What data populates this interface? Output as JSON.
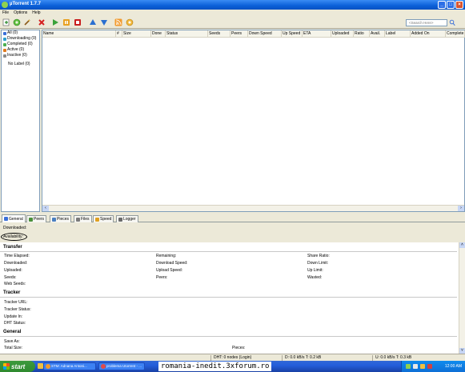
{
  "window": {
    "title": "µTorrent 1.7.7"
  },
  "menu": [
    "File",
    "Options",
    "Help"
  ],
  "toolbar": {
    "buttons": [
      "add-torrent-icon",
      "add-url-icon",
      "create-torrent-icon",
      "remove-icon",
      "start-icon",
      "pause-icon",
      "stop-icon",
      "move-up-icon",
      "move-down-icon",
      "rss-icon",
      "preferences-icon"
    ],
    "search_placeholder": "<Search Here>"
  },
  "sidebar": {
    "items": [
      {
        "label": "All (0)",
        "color": "#3a6fd8"
      },
      {
        "label": "Downloading (0)",
        "color": "#2f9fd0"
      },
      {
        "label": "Completed (0)",
        "color": "#4caf50"
      },
      {
        "label": "Active (0)",
        "color": "#e07a1f"
      },
      {
        "label": "Inactive (0)",
        "color": "#8b8b8b"
      }
    ],
    "no_label": "No Label (0)"
  },
  "columns": [
    "Name",
    "#",
    "Size",
    "Done",
    "Status",
    "Seeds",
    "Peers",
    "Down Speed",
    "Up Speed",
    "ETA",
    "Uploaded",
    "Ratio",
    "Avail.",
    "Label",
    "Added On",
    "Complete"
  ],
  "tabs": [
    {
      "label": "General",
      "color": "#3a6fd8"
    },
    {
      "label": "Peers",
      "color": "#4a8f3a"
    },
    {
      "label": "Pieces",
      "color": "#4a7fc0"
    },
    {
      "label": "Files",
      "color": "#7a7a7a"
    },
    {
      "label": "Speed",
      "color": "#e0a020"
    },
    {
      "label": "Logger",
      "color": "#6a6a6a"
    }
  ],
  "general": {
    "downloaded": "Downloaded:",
    "availability": "Availability:",
    "transfer": {
      "title": "Transfer",
      "col1": [
        "Time Elapsed:",
        "Downloaded:",
        "Uploaded:",
        "Seeds:",
        "Web Seeds:"
      ],
      "col2": [
        "Remaining:",
        "Download Speed:",
        "Upload Speed:",
        "Peers:"
      ],
      "col3": [
        "Share Ratio:",
        "Down Limit:",
        "Up Limit:",
        "Wasted:"
      ]
    },
    "tracker": {
      "title": "Tracker",
      "rows": [
        "Tracker URL:",
        "Tracker Status:",
        "Update In:",
        "DHT Status:"
      ]
    },
    "general_section": {
      "title": "General",
      "save_as": "Save As:",
      "total_size": "Total Size:",
      "pieces": "Pieces:"
    }
  },
  "statusbar": {
    "dht": "DHT: 0 nodes (Login)",
    "down": "D: 0.0 kB/s T: 0.2 kB",
    "up": "U: 0.0 kB/s T: 0.3 kB"
  },
  "taskbar": {
    "start": "start",
    "tasks": [
      "STM: Adnana Antoni...",
      "problema Utorrent - ..."
    ],
    "watermark": "romania-inedit.3xforum.ro",
    "clock": "12:00 AM"
  }
}
